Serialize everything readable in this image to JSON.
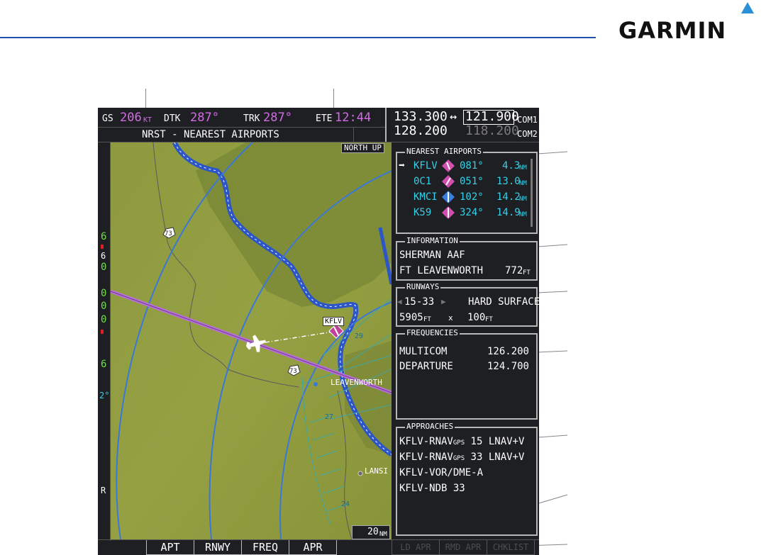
{
  "brand": {
    "logo_text": "GARMIN"
  },
  "top_bar": {
    "gs_label": "GS",
    "gs_value": "206",
    "gs_unit": "KT",
    "dtk_label": "DTK",
    "dtk_value": "287°",
    "trk_label": "TRK",
    "trk_value": "287°",
    "ete_label": "ETE",
    "ete_value": "12:44",
    "page_title": "NRST - NEAREST AIRPORTS"
  },
  "com": {
    "active1": "133.300",
    "swap_arrow": "↔",
    "standby1": "121.900",
    "label1": "COM1",
    "active2": "128.200",
    "standby2": "118.200",
    "label2": "COM2"
  },
  "map": {
    "orientation": "NORTH UP",
    "range": "20",
    "range_unit": "NM",
    "airport_label": "KFLV",
    "city_label": "LEAVENWORTH",
    "city_label2": "LANSI",
    "road1": "73",
    "road2": "73",
    "road_num3": "27",
    "road_num4": "24",
    "road_num5": "29"
  },
  "left_strip": {
    "n1": "6",
    "n2": "6",
    "n3": "0",
    "n4": "0",
    "n5": "0",
    "n6": "0",
    "n7": "6",
    "n8": "2°",
    "n9": "R"
  },
  "nearest_airports": {
    "title": "NEAREST AIRPORTS",
    "rows": [
      {
        "ident": "KFLV",
        "brg": "081°",
        "dist": "4.3",
        "unit": "NM",
        "icon_color": "#d24fb0"
      },
      {
        "ident": "0C1",
        "brg": "051°",
        "dist": "13.0",
        "unit": "NM",
        "icon_color": "#d24fb0"
      },
      {
        "ident": "KMCI",
        "brg": "102°",
        "dist": "14.2",
        "unit": "NM",
        "icon_color": "#3a7fe0"
      },
      {
        "ident": "K59",
        "brg": "324°",
        "dist": "14.9",
        "unit": "NM",
        "icon_color": "#d24fb0"
      }
    ]
  },
  "information": {
    "title": "INFORMATION",
    "name": "SHERMAN AAF",
    "city": "FT LEAVENWORTH",
    "elev": "772",
    "elev_unit": "FT"
  },
  "runways": {
    "title": "RUNWAYS",
    "runway": "15-33",
    "surface": "HARD SURFACE",
    "length": "5905",
    "length_unit": "FT",
    "x": "x",
    "width": "100",
    "width_unit": "FT"
  },
  "frequencies": {
    "title": "FREQUENCIES",
    "rows": [
      {
        "name": "MULTICOM",
        "freq": "126.200"
      },
      {
        "name": "DEPARTURE",
        "freq": "124.700"
      }
    ]
  },
  "approaches": {
    "title": "APPROACHES",
    "rows": [
      {
        "prefix": "KFLV-RNAV",
        "sub": "GPS",
        "suffix": " 15 LNAV+V"
      },
      {
        "prefix": "KFLV-RNAV",
        "sub": "GPS",
        "suffix": " 33 LNAV+V"
      },
      {
        "prefix": "KFLV-VOR/DME-A",
        "sub": "",
        "suffix": ""
      },
      {
        "prefix": "KFLV-NDB 33",
        "sub": "",
        "suffix": ""
      }
    ]
  },
  "softkeys": [
    "APT",
    "RNWY",
    "FREQ",
    "APR",
    "LD APR",
    "RMD APR",
    "CHKLIST"
  ],
  "colors": {
    "accent_line": "#1f4fa8",
    "logo_triangle": "#2a8fd6",
    "magenta": "#d36be6",
    "cyan": "#35d0e8",
    "map_green": "#8c9a3c",
    "route_line": "#b86fd8"
  }
}
